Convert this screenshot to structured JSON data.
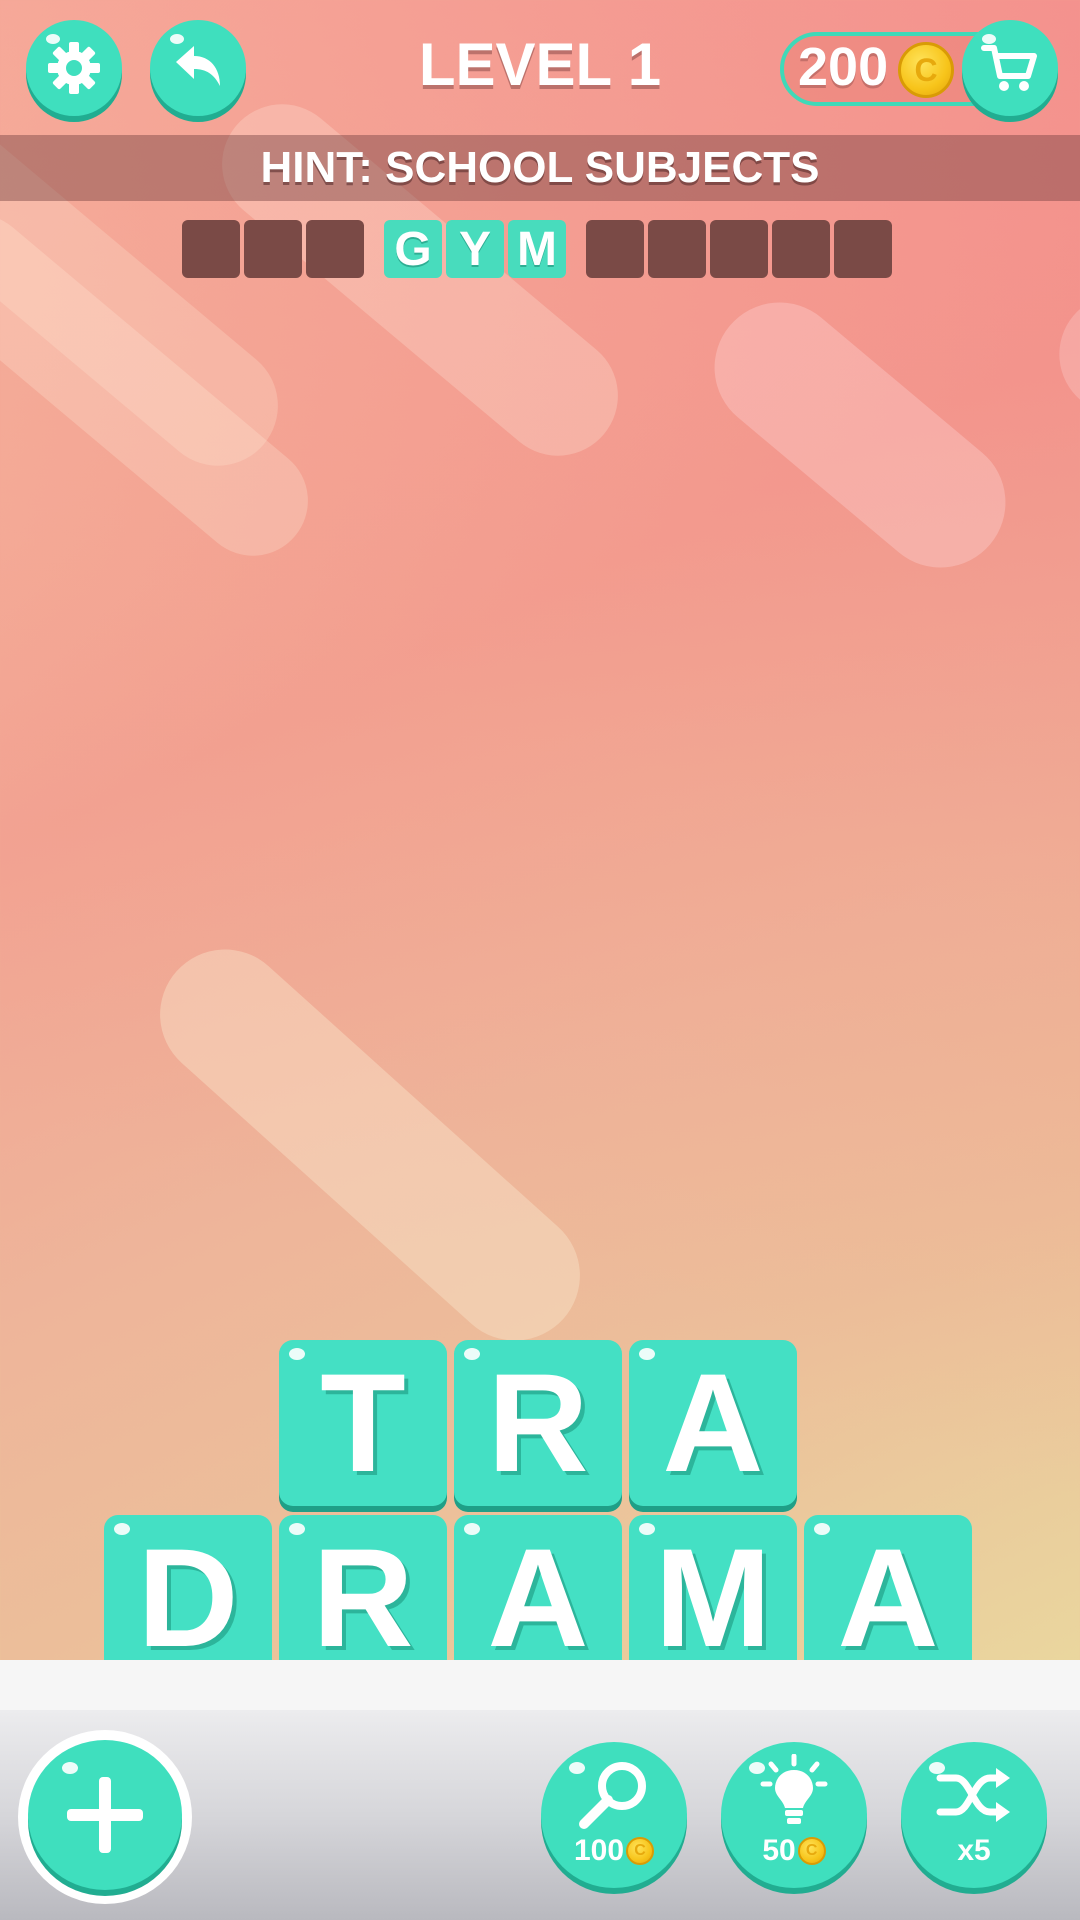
{
  "header": {
    "level_title": "LEVEL 1",
    "coins": "200",
    "coin_symbol": "C"
  },
  "hint": {
    "text": "HINT: SCHOOL SUBJECTS"
  },
  "answer_slots": {
    "word1": [
      "",
      "",
      ""
    ],
    "word2": [
      "G",
      "Y",
      "M"
    ],
    "word3": [
      "",
      "",
      "",
      "",
      ""
    ]
  },
  "tiles": {
    "row1": [
      "T",
      "R",
      "A"
    ],
    "row2": [
      "D",
      "R",
      "A",
      "M",
      "A"
    ]
  },
  "powerups": {
    "search_cost": "100",
    "hint_cost": "50",
    "shuffle_count": "x5"
  },
  "icons": {
    "settings": "gear-icon",
    "back": "undo-arrow-icon",
    "shop": "cart-icon",
    "add": "plus-icon",
    "search": "magnifier-icon",
    "hint": "lightbulb-icon",
    "shuffle": "shuffle-icon"
  },
  "colors": {
    "accent": "#3fdfbe",
    "slot_empty": "#7a4a46",
    "coin": "#f7c41a"
  }
}
